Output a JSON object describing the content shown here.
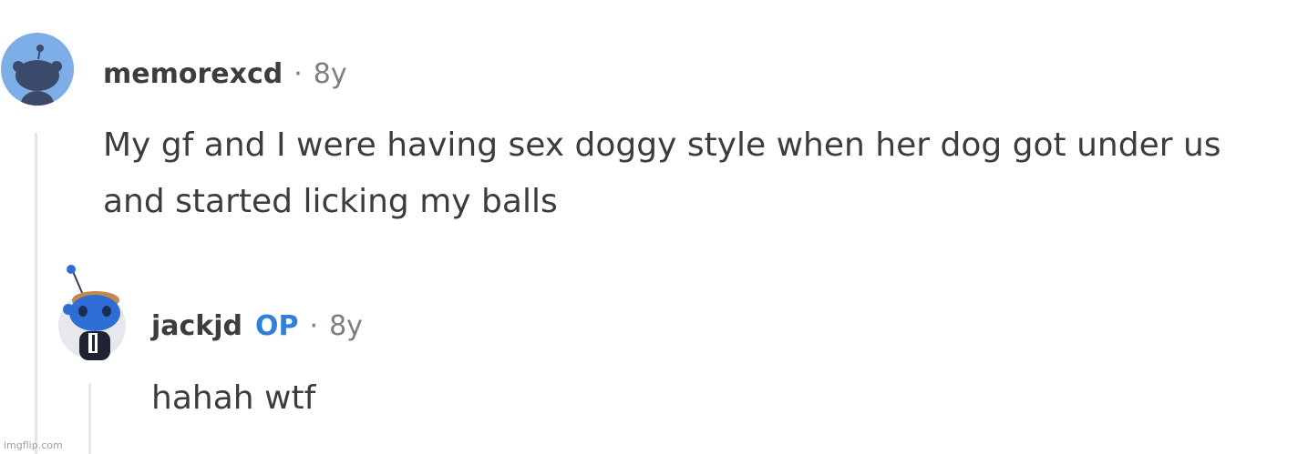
{
  "comments": [
    {
      "username": "memorexcd",
      "separator": "·",
      "age": "8y",
      "body": "My gf and I were having sex doggy style when her dog got under us and started licking my balls"
    },
    {
      "username": "jackjd",
      "badge": "OP",
      "separator": "·",
      "age": "8y",
      "body": "hahah wtf"
    }
  ],
  "watermark": "imgflip.com",
  "colors": {
    "op_badge": "#2f80d9",
    "avatar_bg_1": "#7eaee8",
    "avatar_bg_2": "#e6e8ec",
    "snoo_blue": "#2e6fd6"
  }
}
